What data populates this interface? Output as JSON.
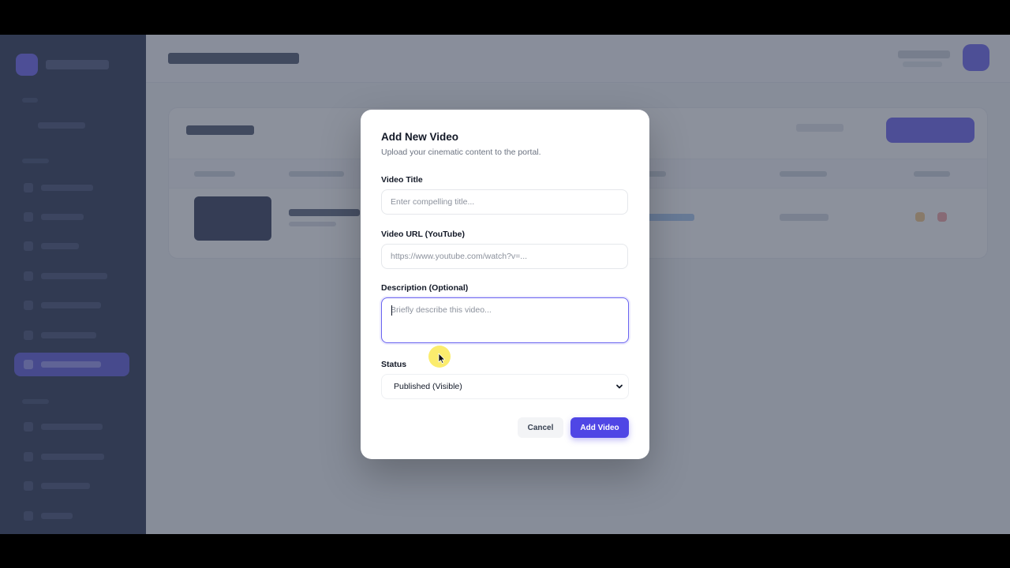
{
  "modal": {
    "title": "Add New Video",
    "subtitle": "Upload your cinematic content to the portal.",
    "video_title": {
      "label": "Video Title",
      "placeholder": "Enter compelling title...",
      "value": ""
    },
    "video_url": {
      "label": "Video URL (YouTube)",
      "placeholder": "https://www.youtube.com/watch?v=...",
      "value": ""
    },
    "description": {
      "label": "Description (Optional)",
      "placeholder": "Briefly describe this video...",
      "value": ""
    },
    "status": {
      "label": "Status",
      "selected": "Published (Visible)",
      "icon": "chevron-down-icon"
    },
    "cancel_label": "Cancel",
    "submit_label": "Add Video"
  },
  "colors": {
    "accent": "#4f46e5",
    "sidebar_bg": "#101c3d",
    "overlay": "rgba(70,78,96,0.62)"
  }
}
